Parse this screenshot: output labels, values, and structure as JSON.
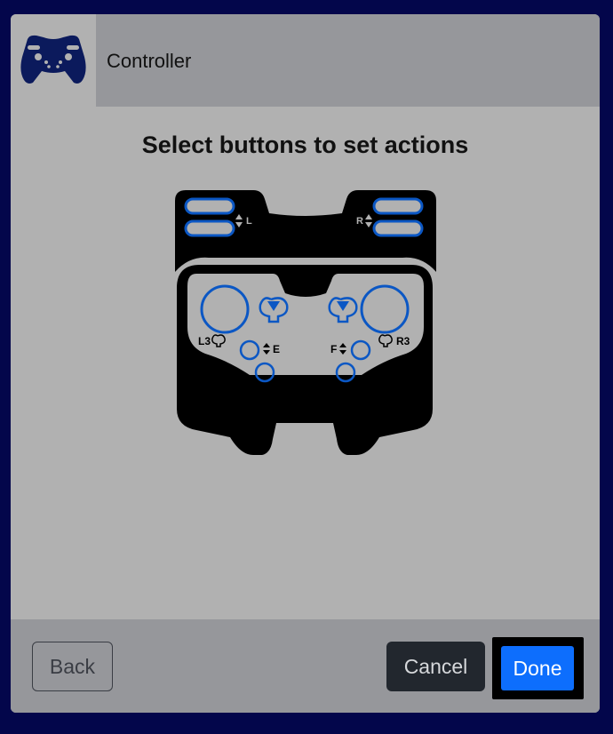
{
  "header": {
    "title": "Controller",
    "icon": "gamepad-icon"
  },
  "instruction": "Select buttons to set actions",
  "controller": {
    "labels": {
      "left_bumper": "L",
      "right_bumper": "R",
      "left_stick": "L3",
      "right_stick": "R3",
      "left_small": "E",
      "right_small": "F"
    }
  },
  "footer": {
    "back_label": "Back",
    "cancel_label": "Cancel",
    "done_label": "Done"
  },
  "colors": {
    "background": "#03064b",
    "panel": "#b1b1b1",
    "header": "#96979b",
    "accent_blue": "#0d6efd",
    "outline_blue": "#0b57c4",
    "dark_button": "#22272e"
  }
}
